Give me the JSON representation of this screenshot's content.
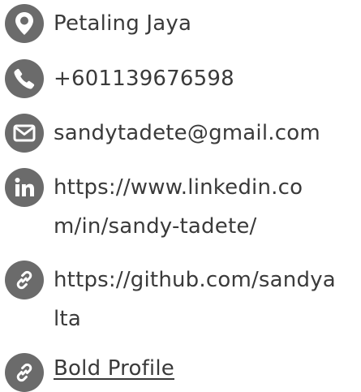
{
  "contact": {
    "location": "Petaling Jaya",
    "phone": "+601139676598",
    "email": "sandytadete@gmail.com",
    "linkedin": "https://www.linkedin.com/in/sandy-tadete/",
    "github": "https://github.com/sandyalta",
    "profile_link": "Bold Profile"
  },
  "icons": {
    "location": "map-pin-icon",
    "phone": "phone-icon",
    "email": "envelope-icon",
    "linkedin": "linkedin-icon",
    "github": "link-icon",
    "profile": "link-icon"
  },
  "colors": {
    "icon_bg": "#6b6b6b",
    "text": "#3a3a3a"
  }
}
